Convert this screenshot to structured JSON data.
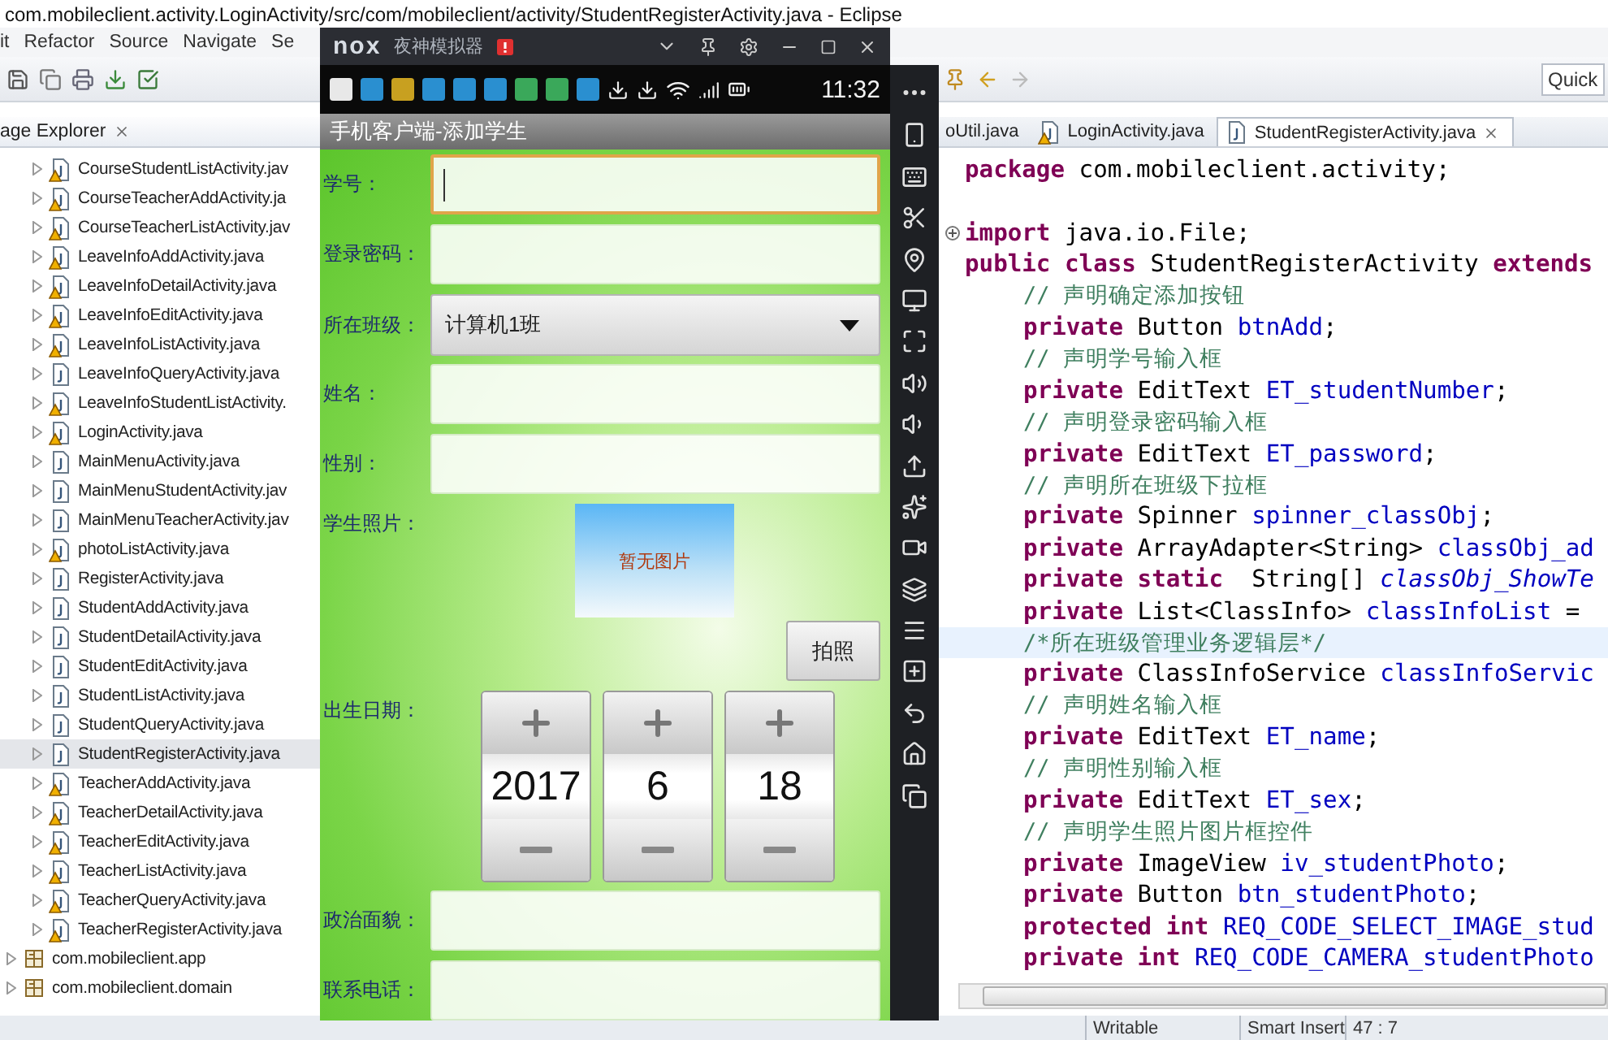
{
  "eclipse": {
    "title": "com.mobileclient.activity.LoginActivity/src/com/mobileclient/activity/StudentRegisterActivity.java - Eclipse",
    "menu": [
      "it",
      "Refactor",
      "Source",
      "Navigate",
      "Se"
    ],
    "quick_access": "Quick",
    "explorer": {
      "tab": "age Explorer",
      "items": [
        {
          "kind": "file",
          "label": "CourseStudentListActivity.jav",
          "warning": true,
          "selected": false
        },
        {
          "kind": "file",
          "label": "CourseTeacherAddActivity.ja",
          "warning": true,
          "selected": false
        },
        {
          "kind": "file",
          "label": "CourseTeacherListActivity.jav",
          "warning": true,
          "selected": false
        },
        {
          "kind": "file",
          "label": "LeaveInfoAddActivity.java",
          "warning": true,
          "selected": false
        },
        {
          "kind": "file",
          "label": "LeaveInfoDetailActivity.java",
          "warning": true,
          "selected": false
        },
        {
          "kind": "file",
          "label": "LeaveInfoEditActivity.java",
          "warning": true,
          "selected": false
        },
        {
          "kind": "file",
          "label": "LeaveInfoListActivity.java",
          "warning": true,
          "selected": false
        },
        {
          "kind": "file",
          "label": "LeaveInfoQueryActivity.java",
          "warning": false,
          "selected": false
        },
        {
          "kind": "file",
          "label": "LeaveInfoStudentListActivity.",
          "warning": true,
          "selected": false
        },
        {
          "kind": "file",
          "label": "LoginActivity.java",
          "warning": true,
          "selected": false
        },
        {
          "kind": "file",
          "label": "MainMenuActivity.java",
          "warning": false,
          "selected": false
        },
        {
          "kind": "file",
          "label": "MainMenuStudentActivity.jav",
          "warning": false,
          "selected": false
        },
        {
          "kind": "file",
          "label": "MainMenuTeacherActivity.jav",
          "warning": false,
          "selected": false
        },
        {
          "kind": "file",
          "label": "photoListActivity.java",
          "warning": true,
          "selected": false
        },
        {
          "kind": "file",
          "label": "RegisterActivity.java",
          "warning": false,
          "selected": false
        },
        {
          "kind": "file",
          "label": "StudentAddActivity.java",
          "warning": false,
          "selected": false
        },
        {
          "kind": "file",
          "label": "StudentDetailActivity.java",
          "warning": false,
          "selected": false
        },
        {
          "kind": "file",
          "label": "StudentEditActivity.java",
          "warning": false,
          "selected": false
        },
        {
          "kind": "file",
          "label": "StudentListActivity.java",
          "warning": false,
          "selected": false
        },
        {
          "kind": "file",
          "label": "StudentQueryActivity.java",
          "warning": false,
          "selected": false
        },
        {
          "kind": "file",
          "label": "StudentRegisterActivity.java",
          "warning": false,
          "selected": true
        },
        {
          "kind": "file",
          "label": "TeacherAddActivity.java",
          "warning": true,
          "selected": false
        },
        {
          "kind": "file",
          "label": "TeacherDetailActivity.java",
          "warning": true,
          "selected": false
        },
        {
          "kind": "file",
          "label": "TeacherEditActivity.java",
          "warning": true,
          "selected": false
        },
        {
          "kind": "file",
          "label": "TeacherListActivity.java",
          "warning": true,
          "selected": false
        },
        {
          "kind": "file",
          "label": "TeacherQueryActivity.java",
          "warning": true,
          "selected": false
        },
        {
          "kind": "file",
          "label": "TeacherRegisterActivity.java",
          "warning": true,
          "selected": false
        },
        {
          "kind": "package",
          "label": "com.mobileclient.app",
          "selected": false
        },
        {
          "kind": "package",
          "label": "com.mobileclient.domain",
          "selected": false
        }
      ]
    },
    "editor": {
      "tabs": [
        {
          "label": "oUtil.java",
          "selected": false,
          "icon": false
        },
        {
          "label": "LoginActivity.java",
          "selected": false,
          "icon": true,
          "warning": true
        },
        {
          "label": "StudentRegisterActivity.java",
          "selected": true,
          "icon": true,
          "warning": false
        }
      ],
      "lines": [
        {
          "kind": "code",
          "indent": false,
          "highlighted": false,
          "fold": false,
          "parts": [
            {
              "kind": "keyword",
              "text": "package"
            },
            {
              "kind": "plain",
              "text": " com.mobileclient.activity;"
            }
          ]
        },
        {
          "kind": "blank",
          "highlighted": false
        },
        {
          "kind": "code",
          "indent": false,
          "highlighted": false,
          "fold": true,
          "parts": [
            {
              "kind": "keyword",
              "text": "import"
            },
            {
              "kind": "plain",
              "text": " java.io.File;"
            }
          ]
        },
        {
          "kind": "code",
          "indent": false,
          "highlighted": false,
          "fold": false,
          "parts": [
            {
              "kind": "keyword",
              "text": "public class"
            },
            {
              "kind": "plain",
              "text": " StudentRegisterActivity "
            },
            {
              "kind": "keyword",
              "text": "extends"
            }
          ]
        },
        {
          "kind": "code",
          "indent": true,
          "highlighted": false,
          "fold": false,
          "parts": [
            {
              "kind": "comment",
              "text": "// 声明确定添加按钮"
            }
          ]
        },
        {
          "kind": "code",
          "indent": true,
          "highlighted": false,
          "fold": false,
          "parts": [
            {
              "kind": "keyword",
              "text": "private"
            },
            {
              "kind": "plain",
              "text": " Button "
            },
            {
              "kind": "field",
              "text": "btnAdd"
            },
            {
              "kind": "plain",
              "text": ";"
            }
          ]
        },
        {
          "kind": "code",
          "indent": true,
          "highlighted": false,
          "fold": false,
          "parts": [
            {
              "kind": "comment",
              "text": "// 声明学号输入框"
            }
          ]
        },
        {
          "kind": "code",
          "indent": true,
          "highlighted": false,
          "fold": false,
          "parts": [
            {
              "kind": "keyword",
              "text": "private"
            },
            {
              "kind": "plain",
              "text": " EditText "
            },
            {
              "kind": "field",
              "text": "ET_studentNumber"
            },
            {
              "kind": "plain",
              "text": ";"
            }
          ]
        },
        {
          "kind": "code",
          "indent": true,
          "highlighted": false,
          "fold": false,
          "parts": [
            {
              "kind": "comment",
              "text": "// 声明登录密码输入框"
            }
          ]
        },
        {
          "kind": "code",
          "indent": true,
          "highlighted": false,
          "fold": false,
          "parts": [
            {
              "kind": "keyword",
              "text": "private"
            },
            {
              "kind": "plain",
              "text": " EditText "
            },
            {
              "kind": "field",
              "text": "ET_password"
            },
            {
              "kind": "plain",
              "text": ";"
            }
          ]
        },
        {
          "kind": "code",
          "indent": true,
          "highlighted": false,
          "fold": false,
          "parts": [
            {
              "kind": "comment",
              "text": "// 声明所在班级下拉框"
            }
          ]
        },
        {
          "kind": "code",
          "indent": true,
          "highlighted": false,
          "fold": false,
          "parts": [
            {
              "kind": "keyword",
              "text": "private"
            },
            {
              "kind": "plain",
              "text": " Spinner "
            },
            {
              "kind": "field",
              "text": "spinner_classObj"
            },
            {
              "kind": "plain",
              "text": ";"
            }
          ]
        },
        {
          "kind": "code",
          "indent": true,
          "highlighted": false,
          "fold": false,
          "parts": [
            {
              "kind": "keyword",
              "text": "private"
            },
            {
              "kind": "plain",
              "text": " ArrayAdapter<String> "
            },
            {
              "kind": "field",
              "text": "classObj_ad"
            }
          ]
        },
        {
          "kind": "code",
          "indent": true,
          "highlighted": false,
          "fold": false,
          "parts": [
            {
              "kind": "keyword",
              "text": "private static"
            },
            {
              "kind": "plain",
              "text": "  String[] "
            },
            {
              "kind": "static",
              "text": "classObj_ShowTe"
            }
          ]
        },
        {
          "kind": "code",
          "indent": true,
          "highlighted": false,
          "fold": false,
          "parts": [
            {
              "kind": "keyword",
              "text": "private"
            },
            {
              "kind": "plain",
              "text": " List<ClassInfo> "
            },
            {
              "kind": "field",
              "text": "classInfoList"
            },
            {
              "kind": "plain",
              "text": " ="
            }
          ]
        },
        {
          "kind": "code",
          "indent": true,
          "highlighted": true,
          "fold": false,
          "parts": [
            {
              "kind": "comment",
              "text": "/*所在班级管理业务逻辑层*/"
            }
          ]
        },
        {
          "kind": "code",
          "indent": true,
          "highlighted": false,
          "fold": false,
          "parts": [
            {
              "kind": "keyword",
              "text": "private"
            },
            {
              "kind": "plain",
              "text": " ClassInfoService "
            },
            {
              "kind": "field",
              "text": "classInfoServic"
            }
          ]
        },
        {
          "kind": "code",
          "indent": true,
          "highlighted": false,
          "fold": false,
          "parts": [
            {
              "kind": "comment",
              "text": "// 声明姓名输入框"
            }
          ]
        },
        {
          "kind": "code",
          "indent": true,
          "highlighted": false,
          "fold": false,
          "parts": [
            {
              "kind": "keyword",
              "text": "private"
            },
            {
              "kind": "plain",
              "text": " EditText "
            },
            {
              "kind": "field",
              "text": "ET_name"
            },
            {
              "kind": "plain",
              "text": ";"
            }
          ]
        },
        {
          "kind": "code",
          "indent": true,
          "highlighted": false,
          "fold": false,
          "parts": [
            {
              "kind": "comment",
              "text": "// 声明性别输入框"
            }
          ]
        },
        {
          "kind": "code",
          "indent": true,
          "highlighted": false,
          "fold": false,
          "parts": [
            {
              "kind": "keyword",
              "text": "private"
            },
            {
              "kind": "plain",
              "text": " EditText "
            },
            {
              "kind": "field",
              "text": "ET_sex"
            },
            {
              "kind": "plain",
              "text": ";"
            }
          ]
        },
        {
          "kind": "code",
          "indent": true,
          "highlighted": false,
          "fold": false,
          "parts": [
            {
              "kind": "comment",
              "text": "// 声明学生照片图片框控件"
            }
          ]
        },
        {
          "kind": "code",
          "indent": true,
          "highlighted": false,
          "fold": false,
          "parts": [
            {
              "kind": "keyword",
              "text": "private"
            },
            {
              "kind": "plain",
              "text": " ImageView "
            },
            {
              "kind": "field",
              "text": "iv_studentPhoto"
            },
            {
              "kind": "plain",
              "text": ";"
            }
          ]
        },
        {
          "kind": "code",
          "indent": true,
          "highlighted": false,
          "fold": false,
          "parts": [
            {
              "kind": "keyword",
              "text": "private"
            },
            {
              "kind": "plain",
              "text": " Button "
            },
            {
              "kind": "field",
              "text": "btn_studentPhoto"
            },
            {
              "kind": "plain",
              "text": ";"
            }
          ]
        },
        {
          "kind": "code",
          "indent": true,
          "highlighted": false,
          "fold": false,
          "parts": [
            {
              "kind": "keyword",
              "text": "protected int "
            },
            {
              "kind": "field",
              "text": "REQ_CODE_SELECT_IMAGE_stud"
            }
          ]
        },
        {
          "kind": "code",
          "indent": true,
          "highlighted": false,
          "fold": false,
          "parts": [
            {
              "kind": "keyword",
              "text": "private int "
            },
            {
              "kind": "field",
              "text": "REQ_CODE_CAMERA_studentPhoto"
            }
          ]
        }
      ]
    },
    "status_bar": [
      "Writable",
      "Smart Insert",
      "47 : 7"
    ]
  },
  "emulator": {
    "logo": "nox",
    "title": "夜神模拟器",
    "time": "11:32",
    "app_title": "手机客户端-添加学生",
    "rows": [
      {
        "kind": "input",
        "label": "学号：",
        "focused": true
      },
      {
        "kind": "input",
        "label": "登录密码：",
        "focused": false
      },
      {
        "kind": "spinner",
        "label": "所在班级：",
        "value": "计算机1班"
      },
      {
        "kind": "input",
        "label": "姓名：",
        "focused": false
      },
      {
        "kind": "input",
        "label": "性别：",
        "focused": false
      },
      {
        "kind": "photo",
        "label": "学生照片：",
        "photo_text": "暂无图片",
        "button": "拍照"
      },
      {
        "kind": "date",
        "label": "出生日期：",
        "values": [
          "2017",
          "6",
          "18"
        ]
      },
      {
        "kind": "input",
        "label": "政治面貌：",
        "focused": false
      },
      {
        "kind": "input",
        "label": "联系电话：",
        "focused": false
      }
    ]
  }
}
